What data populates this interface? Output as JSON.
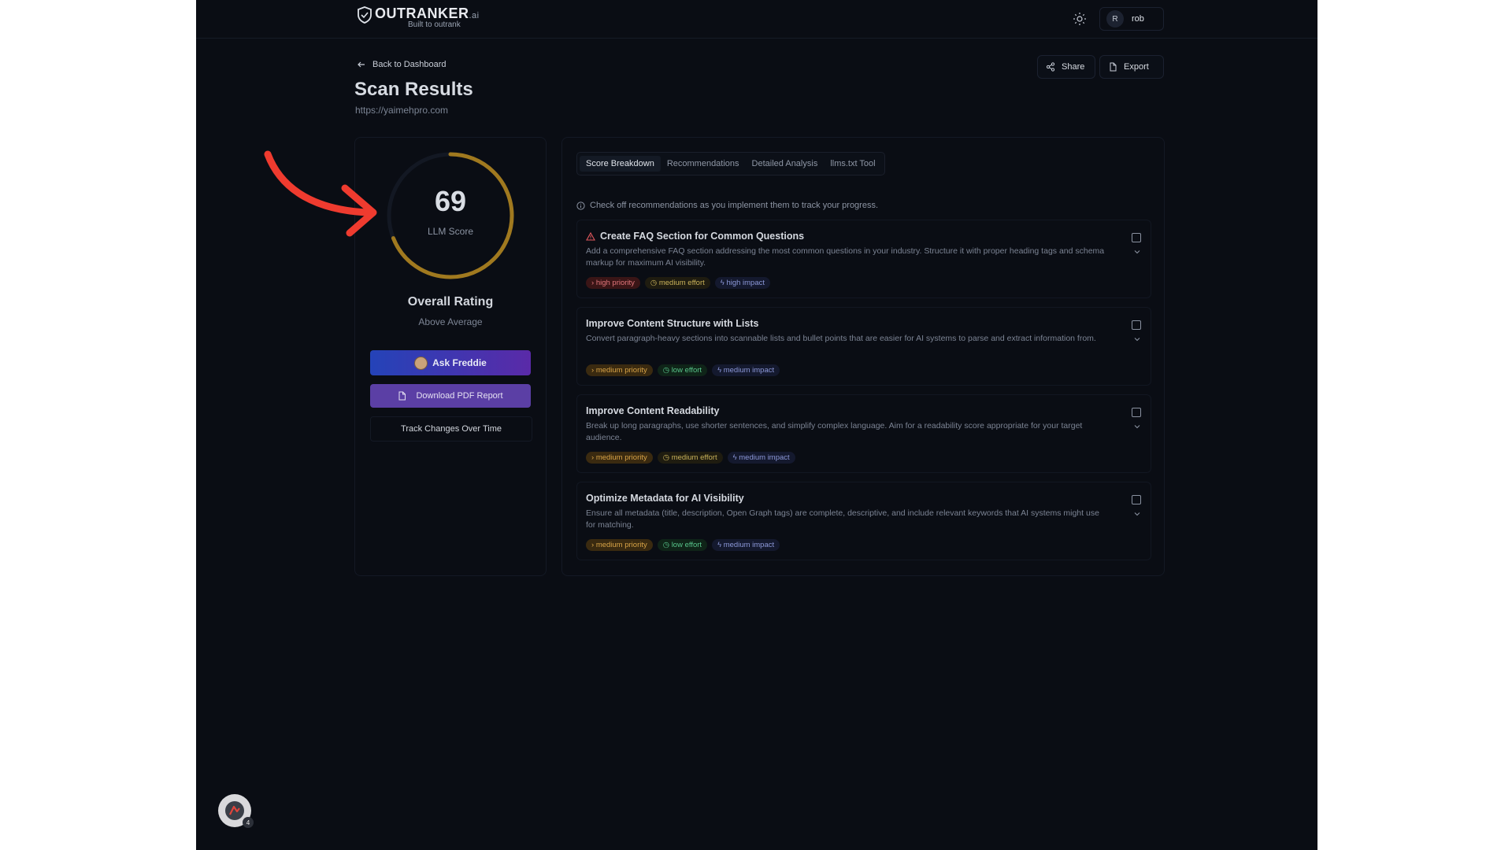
{
  "app": {
    "logo_text": "OUTRANKER",
    "logo_suffix": ".ai",
    "tagline": "Built to outrank"
  },
  "header": {
    "avatar_initial": "R",
    "username": "rob"
  },
  "nav": {
    "back_label": "Back to Dashboard"
  },
  "page": {
    "title": "Scan Results",
    "url": "https://yaimehpro.com"
  },
  "actions": {
    "share_label": "Share",
    "export_label": "Export"
  },
  "score_card": {
    "score": "69",
    "score_label": "LLM Score",
    "score_fraction": 0.69,
    "rating_title": "Overall Rating",
    "rating_value": "Above Average",
    "ask_label": "Ask Freddie",
    "pdf_label": "Download PDF Report",
    "track_label": "Track Changes Over Time",
    "gauge_color": "#a0791f"
  },
  "tabs": [
    {
      "label": "Score Breakdown",
      "active": true
    },
    {
      "label": "Recommendations",
      "active": false
    },
    {
      "label": "Detailed Analysis",
      "active": false
    },
    {
      "label": "llms.txt Tool",
      "active": false
    }
  ],
  "hint": "Check off recommendations as you implement them to track your progress.",
  "recommendations": [
    {
      "title": "Create FAQ Section for Common Questions",
      "icon": "warning-icon",
      "description": "Add a comprehensive FAQ section addressing the most common questions in your industry. Structure it with proper heading tags and schema markup for maximum AI visibility.",
      "priority": "high priority",
      "effort": "medium effort",
      "impact": "high impact"
    },
    {
      "title": "Improve Content Structure with Lists",
      "icon": "",
      "description": "Convert paragraph-heavy sections into scannable lists and bullet points that are easier for AI systems to parse and extract information from.",
      "priority": "medium priority",
      "effort": "low effort",
      "impact": "medium impact"
    },
    {
      "title": "Improve Content Readability",
      "icon": "",
      "description": "Break up long paragraphs, use shorter sentences, and simplify complex language. Aim for a readability score appropriate for your target audience.",
      "priority": "medium priority",
      "effort": "medium effort",
      "impact": "medium impact"
    },
    {
      "title": "Optimize Metadata for AI Visibility",
      "icon": "",
      "description": "Ensure all metadata (title, description, Open Graph tags) are complete, descriptive, and include relevant keywords that AI systems might use for matching.",
      "priority": "medium priority",
      "effort": "low effort",
      "impact": "medium impact"
    }
  ],
  "fab": {
    "count": "4"
  },
  "colors": {
    "annotation_arrow": "#ef3b2f",
    "accent_gradient_start": "#2443b8",
    "accent_gradient_end": "#5a2aa8"
  }
}
